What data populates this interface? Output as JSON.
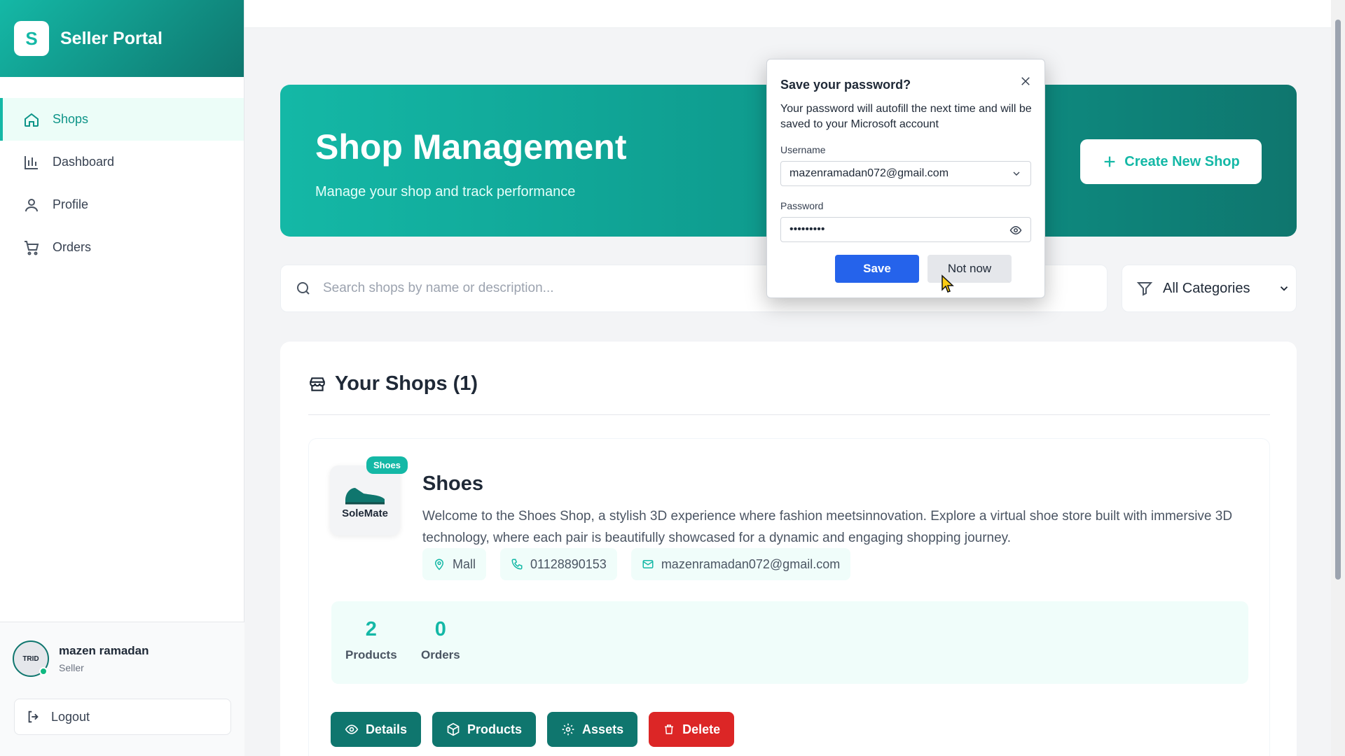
{
  "brand": {
    "logo_letter": "S",
    "title": "Seller Portal"
  },
  "sidebar": {
    "items": [
      {
        "label": "Shops",
        "icon": "home-icon",
        "active": true
      },
      {
        "label": "Dashboard",
        "icon": "bar-chart-icon"
      },
      {
        "label": "Profile",
        "icon": "user-icon"
      },
      {
        "label": "Orders",
        "icon": "cart-icon"
      }
    ]
  },
  "user": {
    "name": "mazen ramadan",
    "role": "Seller",
    "avatar_text": "TRID",
    "logout_label": "Logout"
  },
  "hero": {
    "title": "Shop Management",
    "subtitle": "Manage your shop and track performance",
    "create_label": "Create New Shop"
  },
  "search": {
    "placeholder": "Search shops by name or description...",
    "category": "All Categories"
  },
  "shops_panel": {
    "heading": "Your Shops (1)"
  },
  "shop": {
    "name": "Shoes",
    "badge": "Shoes",
    "image_text": "SoleMate",
    "description": "Welcome to the Shoes Shop, a stylish 3D experience where fashion meetsinnovation. Explore a virtual shoe store built with immersive 3D technology, where each pair is beautifully showcased for a dynamic and engaging shopping journey.",
    "location": "Mall",
    "phone": "01128890153",
    "email": "mazenramadan072@gmail.com",
    "stats": [
      {
        "value": "2",
        "label": "Products"
      },
      {
        "value": "0",
        "label": "Orders"
      }
    ],
    "actions": {
      "details": "Details",
      "products": "Products",
      "assets": "Assets",
      "delete": "Delete"
    }
  },
  "password_dialog": {
    "title": "Save your password?",
    "text": "Your password will autofill the next time and will be saved to your Microsoft account",
    "username_label": "Username",
    "username_value": "mazenramadan072@gmail.com",
    "password_label": "Password",
    "password_value": "•••••••••",
    "save_label": "Save",
    "not_now_label": "Not now"
  },
  "colors": {
    "accent": "#14b8a6",
    "accent_dark": "#0f766e",
    "danger": "#dc2626",
    "dialog_primary": "#2563eb"
  }
}
